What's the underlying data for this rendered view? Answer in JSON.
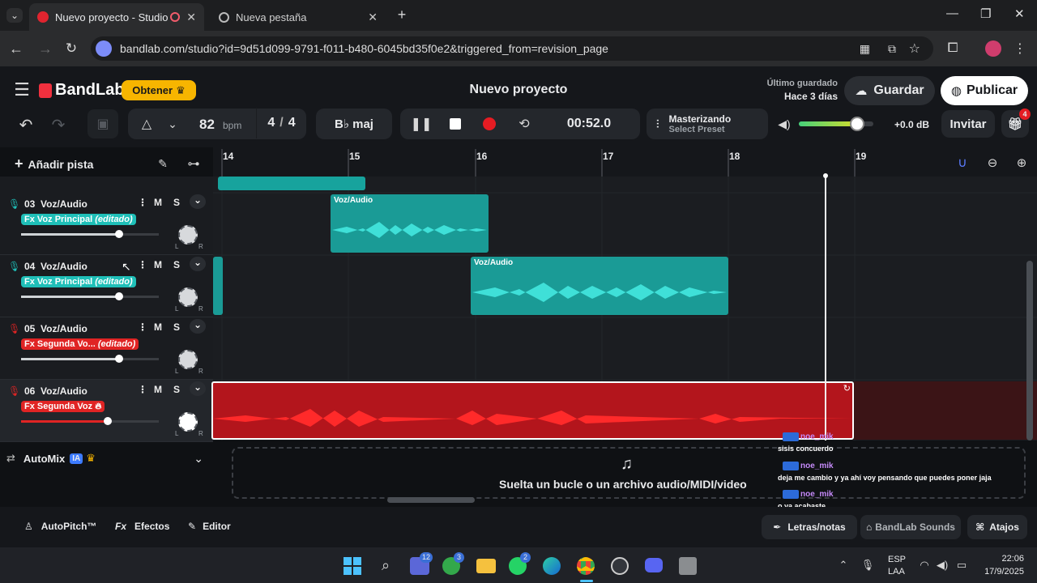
{
  "browser": {
    "tabs": [
      {
        "label": "Nuevo proyecto - Studio",
        "active": true
      },
      {
        "label": "Nueva pestaña",
        "active": false
      }
    ],
    "url": "bandlab.com/studio?id=9d51d099-9791-f011-b480-6045bd35f0e2&triggered_from=revision_page"
  },
  "app": {
    "brand": "BandLab",
    "obtener_label": "Obtener",
    "project_title": "Nuevo proyecto",
    "last_saved_label": "Último guardado",
    "last_saved_value": "Hace 3 días",
    "save_label": "Guardar",
    "publish_label": "Publicar",
    "bpm_value": "82",
    "bpm_unit": "bpm",
    "time_sig_num": "4",
    "time_sig_sep": "/",
    "time_sig_den": "4",
    "key": "B♭ maj",
    "time": "00:52.0",
    "mastering_title": "Masterizando",
    "mastering_sub": "Select Preset",
    "master_volume_db": "+0.0 dB",
    "master_volume_level": 0.78,
    "invite_label": "Invitar",
    "gift_badge": "4",
    "add_track_label": "Añadir pista"
  },
  "ruler": {
    "marks": [
      "14",
      "15",
      "16",
      "17",
      "18",
      "19"
    ]
  },
  "tracks": [
    {
      "num": "03",
      "name": "Voz/Audio",
      "fx": "Fx Voz Principal",
      "fx_edit": "(editado)",
      "color": "#1fbfb8",
      "volume": 0.71
    },
    {
      "num": "04",
      "name": "Voz/Audio",
      "fx": "Fx Voz Principal",
      "fx_edit": "(editado)",
      "color": "#1fbfb8",
      "volume": 0.71
    },
    {
      "num": "05",
      "name": "Voz/Audio",
      "fx": "Fx Segunda Vo...",
      "fx_edit": "(editado)",
      "color": "#e02424",
      "volume": 0.71
    },
    {
      "num": "06",
      "name": "Voz/Audio",
      "fx": "Fx Segunda Voz",
      "fx_edit": "",
      "color": "#e02424",
      "volume": 0.63
    }
  ],
  "track_buttons": {
    "mute": "M",
    "solo": "S",
    "pan_left": "L",
    "pan_right": "R"
  },
  "clips": {
    "label": "Voz/Audio"
  },
  "automix": {
    "label": "AutoMix",
    "badge": "IA"
  },
  "dropzone": {
    "text": "Suelta un bucle o un archivo audio/MIDI/video"
  },
  "chat": [
    {
      "user": "noe_mik",
      "message": "sisis concuerdo"
    },
    {
      "user": "noe_mik",
      "message": "deja me cambio y ya ahí voy pensando que puedes poner jaja"
    },
    {
      "user": "noe_mik",
      "message": "o ya acabaste"
    }
  ],
  "bottom": {
    "autopitch": "AutoPitch™",
    "effects_prefix": "Fx",
    "effects": "Efectos",
    "editor": "Editor",
    "lyrics": "Letras/notas",
    "sounds": "BandLab Sounds",
    "shortcuts": "Atajos"
  },
  "taskbar": {
    "lang1": "ESP",
    "lang2": "LAA",
    "time": "22:06",
    "date": "17/9/2025",
    "badge_teams": "12",
    "badge_xbox": "3",
    "badge_whatsapp": "2"
  },
  "colors": {
    "teal": "#1fbfb8",
    "red": "#e02424",
    "accent_yellow": "#f7b500"
  }
}
